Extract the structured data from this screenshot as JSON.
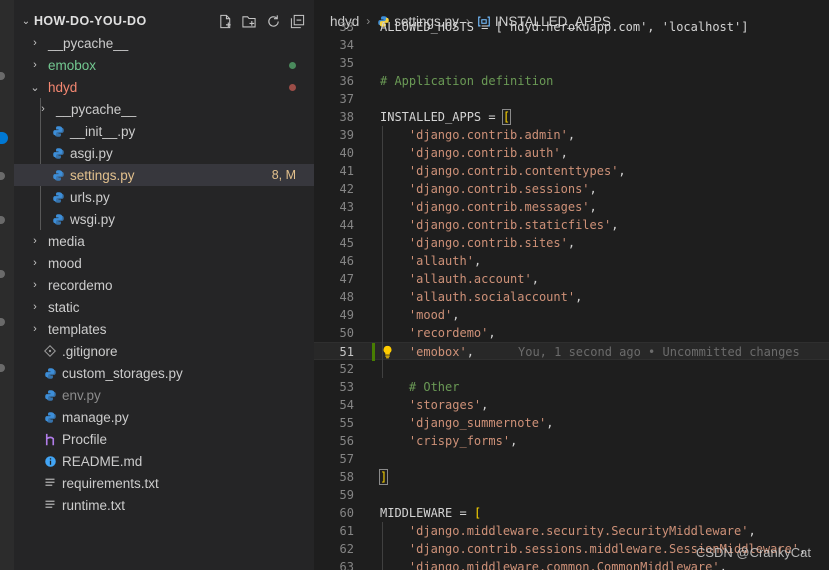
{
  "colors": {
    "sidebar_bg": "#252526",
    "editor_bg": "#1e1e1e",
    "modified": "#e2c08d",
    "untracked": "#73c991",
    "error": "#f48771",
    "string": "#ce9178",
    "comment": "#6a9955",
    "python_icon": "#3d8ed8"
  },
  "explorer": {
    "title": "HOW-DO-YOU-DO",
    "actions": [
      "new-file-icon",
      "new-folder-icon",
      "refresh-icon",
      "collapse-all-icon"
    ],
    "items": [
      {
        "label": "__pycache__",
        "twisty": "›",
        "icon": "",
        "color": "#cccccc",
        "status": ""
      },
      {
        "label": "emobox",
        "twisty": "›",
        "icon": "",
        "color": "#73c991",
        "status": "dot-green"
      },
      {
        "label": "hdyd",
        "twisty": "⌄",
        "icon": "",
        "color": "#f48771",
        "status": "dot-red"
      },
      {
        "label": "__pycache__",
        "twisty": "›",
        "icon": "",
        "color": "#cccccc",
        "status": ""
      },
      {
        "label": "__init__.py",
        "twisty": "",
        "icon": "python-icon",
        "color": "#cccccc",
        "status": ""
      },
      {
        "label": "asgi.py",
        "twisty": "",
        "icon": "python-icon",
        "color": "#cccccc",
        "status": ""
      },
      {
        "label": "settings.py",
        "twisty": "",
        "icon": "python-icon",
        "color": "#e2c08d",
        "status": "8, M"
      },
      {
        "label": "urls.py",
        "twisty": "",
        "icon": "python-icon",
        "color": "#cccccc",
        "status": ""
      },
      {
        "label": "wsgi.py",
        "twisty": "",
        "icon": "python-icon",
        "color": "#cccccc",
        "status": ""
      },
      {
        "label": "media",
        "twisty": "›",
        "icon": "",
        "color": "#cccccc",
        "status": ""
      },
      {
        "label": "mood",
        "twisty": "›",
        "icon": "",
        "color": "#cccccc",
        "status": ""
      },
      {
        "label": "recordemo",
        "twisty": "›",
        "icon": "",
        "color": "#cccccc",
        "status": ""
      },
      {
        "label": "static",
        "twisty": "›",
        "icon": "",
        "color": "#cccccc",
        "status": ""
      },
      {
        "label": "templates",
        "twisty": "›",
        "icon": "",
        "color": "#cccccc",
        "status": ""
      },
      {
        "label": ".gitignore",
        "twisty": "",
        "icon": "git-icon",
        "color": "#cccccc",
        "status": ""
      },
      {
        "label": "custom_storages.py",
        "twisty": "",
        "icon": "python-icon",
        "color": "#cccccc",
        "status": ""
      },
      {
        "label": "env.py",
        "twisty": "",
        "icon": "python-icon",
        "color": "#8c8c8c",
        "status": ""
      },
      {
        "label": "manage.py",
        "twisty": "",
        "icon": "python-icon",
        "color": "#cccccc",
        "status": ""
      },
      {
        "label": "Procfile",
        "twisty": "",
        "icon": "heroku-icon",
        "color": "#cccccc",
        "status": ""
      },
      {
        "label": "README.md",
        "twisty": "",
        "icon": "info-icon",
        "color": "#cccccc",
        "status": ""
      },
      {
        "label": "requirements.txt",
        "twisty": "",
        "icon": "text-file-icon",
        "color": "#cccccc",
        "status": ""
      },
      {
        "label": "runtime.txt",
        "twisty": "",
        "icon": "text-file-icon",
        "color": "#cccccc",
        "status": ""
      }
    ]
  },
  "breadcrumb": {
    "folder": "hdyd",
    "file": "settings.py",
    "symbol": "INSTALLED_APPS"
  },
  "editor": {
    "blame": "You, 1 second ago • Uncommitted changes",
    "lines": [
      {
        "n": "33",
        "tokens": [
          [
            "var",
            "ALLOWED_HOSTS = ['hdyd.herokuapp.com', 'localhost']"
          ]
        ]
      },
      {
        "n": "34",
        "tokens": []
      },
      {
        "n": "35",
        "tokens": []
      },
      {
        "n": "36",
        "tokens": [
          [
            "cmt",
            "# Application definition"
          ]
        ]
      },
      {
        "n": "37",
        "tokens": []
      },
      {
        "n": "38",
        "tokens": [
          [
            "var",
            "INSTALLED_APPS "
          ],
          [
            "op",
            "= "
          ],
          [
            "brhl",
            "["
          ]
        ]
      },
      {
        "n": "39",
        "tokens": [
          [
            "op",
            "    "
          ],
          [
            "str",
            "'django.contrib.admin'"
          ],
          [
            "op",
            ","
          ]
        ]
      },
      {
        "n": "40",
        "tokens": [
          [
            "op",
            "    "
          ],
          [
            "str",
            "'django.contrib.auth'"
          ],
          [
            "op",
            ","
          ]
        ]
      },
      {
        "n": "41",
        "tokens": [
          [
            "op",
            "    "
          ],
          [
            "str",
            "'django.contrib.contenttypes'"
          ],
          [
            "op",
            ","
          ]
        ]
      },
      {
        "n": "42",
        "tokens": [
          [
            "op",
            "    "
          ],
          [
            "str",
            "'django.contrib.sessions'"
          ],
          [
            "op",
            ","
          ]
        ]
      },
      {
        "n": "43",
        "tokens": [
          [
            "op",
            "    "
          ],
          [
            "str",
            "'django.contrib.messages'"
          ],
          [
            "op",
            ","
          ]
        ]
      },
      {
        "n": "44",
        "tokens": [
          [
            "op",
            "    "
          ],
          [
            "str",
            "'django.contrib.staticfiles'"
          ],
          [
            "op",
            ","
          ]
        ]
      },
      {
        "n": "45",
        "tokens": [
          [
            "op",
            "    "
          ],
          [
            "str",
            "'django.contrib.sites'"
          ],
          [
            "op",
            ","
          ]
        ]
      },
      {
        "n": "46",
        "tokens": [
          [
            "op",
            "    "
          ],
          [
            "str",
            "'allauth'"
          ],
          [
            "op",
            ","
          ]
        ]
      },
      {
        "n": "47",
        "tokens": [
          [
            "op",
            "    "
          ],
          [
            "str",
            "'allauth.account'"
          ],
          [
            "op",
            ","
          ]
        ]
      },
      {
        "n": "48",
        "tokens": [
          [
            "op",
            "    "
          ],
          [
            "str",
            "'allauth.socialaccount'"
          ],
          [
            "op",
            ","
          ]
        ]
      },
      {
        "n": "49",
        "tokens": [
          [
            "op",
            "    "
          ],
          [
            "str",
            "'mood'"
          ],
          [
            "op",
            ","
          ]
        ]
      },
      {
        "n": "50",
        "tokens": [
          [
            "op",
            "    "
          ],
          [
            "str",
            "'recordemo'"
          ],
          [
            "op",
            ","
          ]
        ]
      },
      {
        "n": "51",
        "tokens": [
          [
            "op",
            "    "
          ],
          [
            "str",
            "'emobox'"
          ],
          [
            "op",
            ","
          ]
        ],
        "current": true
      },
      {
        "n": "52",
        "tokens": []
      },
      {
        "n": "53",
        "tokens": [
          [
            "op",
            "    "
          ],
          [
            "cmt",
            "# Other"
          ]
        ]
      },
      {
        "n": "54",
        "tokens": [
          [
            "op",
            "    "
          ],
          [
            "str",
            "'storages'"
          ],
          [
            "op",
            ","
          ]
        ]
      },
      {
        "n": "55",
        "tokens": [
          [
            "op",
            "    "
          ],
          [
            "str",
            "'django_summernote'"
          ],
          [
            "op",
            ","
          ]
        ]
      },
      {
        "n": "56",
        "tokens": [
          [
            "op",
            "    "
          ],
          [
            "str",
            "'crispy_forms'"
          ],
          [
            "op",
            ","
          ]
        ]
      },
      {
        "n": "57",
        "tokens": []
      },
      {
        "n": "58",
        "tokens": [
          [
            "brhl",
            "]"
          ]
        ]
      },
      {
        "n": "59",
        "tokens": []
      },
      {
        "n": "60",
        "tokens": [
          [
            "var",
            "MIDDLEWARE "
          ],
          [
            "op",
            "= "
          ],
          [
            "br",
            "["
          ]
        ]
      },
      {
        "n": "61",
        "tokens": [
          [
            "op",
            "    "
          ],
          [
            "str",
            "'django.middleware.security.SecurityMiddleware'"
          ],
          [
            "op",
            ","
          ]
        ]
      },
      {
        "n": "62",
        "tokens": [
          [
            "op",
            "    "
          ],
          [
            "str",
            "'django.contrib.sessions.middleware.SessionMiddleware'"
          ],
          [
            "op",
            ","
          ]
        ]
      },
      {
        "n": "63",
        "tokens": [
          [
            "op",
            "    "
          ],
          [
            "str",
            "'django.middleware.common.CommonMiddleware'"
          ],
          [
            "op",
            ","
          ]
        ]
      }
    ]
  },
  "watermark": "CSDN @CrankyCat"
}
